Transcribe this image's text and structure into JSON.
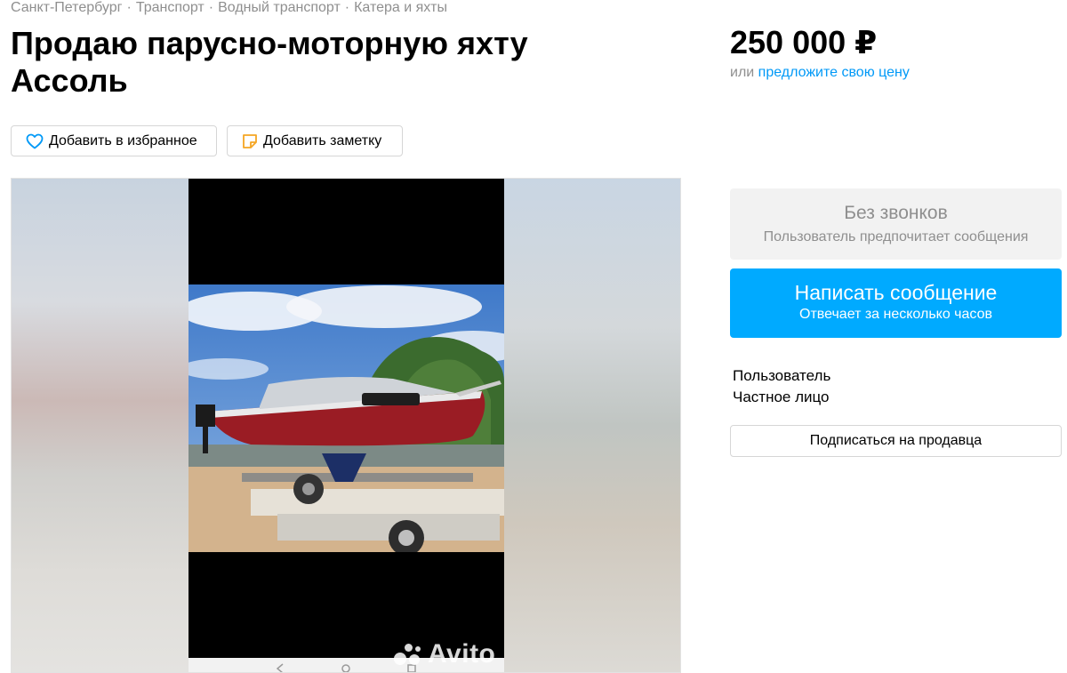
{
  "breadcrumbs": [
    "Санкт-Петербург",
    "Транспорт",
    "Водный транспорт",
    "Катера и яхты"
  ],
  "breadcrumb_separator": "·",
  "title": "Продаю парусно-моторную яхту Ассоль",
  "price": "250 000 ₽",
  "offer": {
    "prefix": "или",
    "link": "предложите свою цену"
  },
  "actions": {
    "favorite": "Добавить в избранное",
    "note": "Добавить заметку"
  },
  "contact": {
    "no_calls_title": "Без звонков",
    "no_calls_subtitle": "Пользователь предпочитает сообщения",
    "message_button": "Написать сообщение",
    "message_subtitle": "Отвечает за несколько часов"
  },
  "seller": {
    "name": "Пользователь",
    "type": "Частное лицо",
    "subscribe": "Подписаться на продавца"
  },
  "gallery": {
    "watermark": "Avito",
    "photo_icon": "boat-on-trailer-photo"
  },
  "colors": {
    "accent": "#00aaff",
    "link": "#0099f7",
    "muted": "#8f8f8f"
  }
}
